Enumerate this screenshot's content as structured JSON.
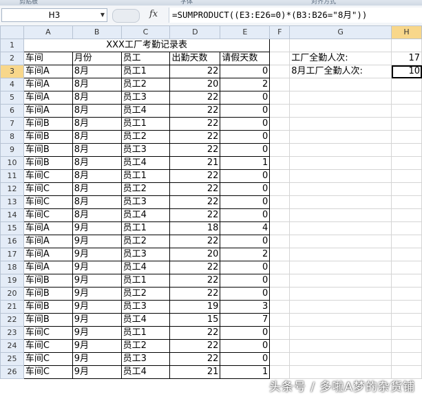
{
  "ribbon": {
    "groups": [
      "剪贴板",
      "字体",
      "对齐方式"
    ]
  },
  "formula_bar": {
    "name_box": "H3",
    "fx": "fx",
    "formula": "=SUMPRODUCT((E3:E26=0)*(B3:B26=\"8月\"))"
  },
  "columns": [
    "A",
    "B",
    "C",
    "D",
    "E",
    "F",
    "G",
    "H"
  ],
  "sheet": {
    "title": "XXX工厂考勤记录表",
    "headers": [
      "车间",
      "月份",
      "员工",
      "出勤天数",
      "请假天数"
    ],
    "rows": [
      [
        "车间A",
        "8月",
        "员工1",
        "22",
        "0"
      ],
      [
        "车间A",
        "8月",
        "员工2",
        "20",
        "2"
      ],
      [
        "车间A",
        "8月",
        "员工3",
        "22",
        "0"
      ],
      [
        "车间A",
        "8月",
        "员工4",
        "22",
        "0"
      ],
      [
        "车间B",
        "8月",
        "员工1",
        "22",
        "0"
      ],
      [
        "车间B",
        "8月",
        "员工2",
        "22",
        "0"
      ],
      [
        "车间B",
        "8月",
        "员工3",
        "22",
        "0"
      ],
      [
        "车间B",
        "8月",
        "员工4",
        "21",
        "1"
      ],
      [
        "车间C",
        "8月",
        "员工1",
        "22",
        "0"
      ],
      [
        "车间C",
        "8月",
        "员工2",
        "22",
        "0"
      ],
      [
        "车间C",
        "8月",
        "员工3",
        "22",
        "0"
      ],
      [
        "车间C",
        "8月",
        "员工4",
        "22",
        "0"
      ],
      [
        "车间A",
        "9月",
        "员工1",
        "18",
        "4"
      ],
      [
        "车间A",
        "9月",
        "员工2",
        "22",
        "0"
      ],
      [
        "车间A",
        "9月",
        "员工3",
        "20",
        "2"
      ],
      [
        "车间A",
        "9月",
        "员工4",
        "22",
        "0"
      ],
      [
        "车间B",
        "9月",
        "员工1",
        "22",
        "0"
      ],
      [
        "车间B",
        "9月",
        "员工2",
        "22",
        "0"
      ],
      [
        "车间B",
        "9月",
        "员工3",
        "19",
        "3"
      ],
      [
        "车间B",
        "9月",
        "员工4",
        "15",
        "7"
      ],
      [
        "车间C",
        "9月",
        "员工1",
        "22",
        "0"
      ],
      [
        "车间C",
        "9月",
        "员工2",
        "22",
        "0"
      ],
      [
        "车间C",
        "9月",
        "员工3",
        "22",
        "0"
      ],
      [
        "车间C",
        "9月",
        "员工4",
        "21",
        "1"
      ]
    ],
    "summary": [
      {
        "label": "工厂全勤人次:",
        "value": "17"
      },
      {
        "label": "8月工厂全勤人次:",
        "value": "10"
      }
    ]
  },
  "active_cell": {
    "column": "H",
    "row": "3"
  },
  "watermark": "头条号 / 多啦A梦的杂货铺"
}
